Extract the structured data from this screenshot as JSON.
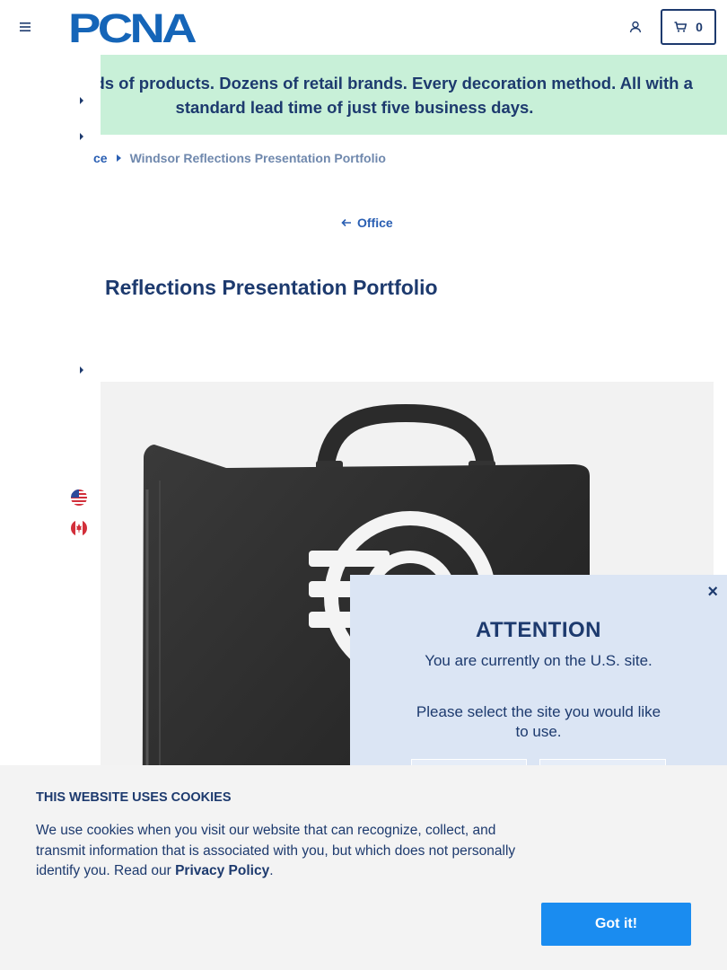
{
  "header": {
    "logo_text": "PCNA",
    "cart_count": "0"
  },
  "banner": {
    "text": "/ Thousands of products. Dozens of retail brands. Every decoration method. All with a standard lead time of just five business days."
  },
  "breadcrumb": {
    "parent": "ce",
    "current": "Windsor Reflections Presentation Portfolio"
  },
  "back_link": {
    "label": "Office"
  },
  "product": {
    "title": "Reflections Presentation Portfolio"
  },
  "attention_modal": {
    "heading": "ATTENTION",
    "message": "You are currently on the U.S. site.",
    "prompt": "Please select the site you would like to use.",
    "close_label": "×"
  },
  "cookie_banner": {
    "heading": "THIS WEBSITE USES COOKIES",
    "text_before": "We use cookies when you visit our website that can recognize, collect, and transmit information that is associated with you, but which does not personally identify you. Read our ",
    "link_text": "Privacy Policy",
    "text_after": ".",
    "button_label": "Got it!"
  },
  "colors": {
    "brand_navy": "#1d3a6e",
    "banner_green": "#c8f0d8",
    "accent_blue": "#1a8cf0",
    "modal_bg": "#dbe5f4"
  }
}
